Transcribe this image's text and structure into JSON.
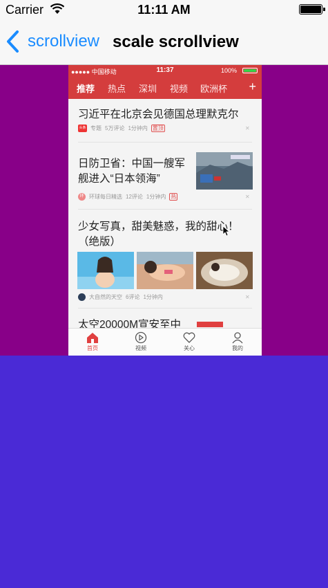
{
  "status_bar": {
    "carrier": "Carrier",
    "time": "11:11 AM"
  },
  "nav": {
    "back_label": "scrollview",
    "title": "scale scrollview"
  },
  "phone": {
    "status": {
      "carrier": "●●●●● 中国移动",
      "time": "11:37",
      "battery": "100%"
    },
    "tabs": [
      {
        "label": "推荐",
        "active": true
      },
      {
        "label": "热点"
      },
      {
        "label": "深圳"
      },
      {
        "label": "视频"
      },
      {
        "label": "欧洲杯"
      }
    ],
    "add_tab_glyph": "+",
    "feed": [
      {
        "headline": "习近平在北京会见德国总理默克尔",
        "source": "专题",
        "comments": "5万评论",
        "time": "1分钟内",
        "tag": "置顶",
        "source_badge": "头条"
      },
      {
        "headline": "日防卫省：中国一艘军舰进入“日本领海”",
        "source": "环球每日精选",
        "comments": "12评论",
        "time": "1分钟内",
        "tag": "热",
        "source_badge": "环"
      },
      {
        "headline": "少女写真，甜美魅惑，我的甜心！（绝版）",
        "source": "大自然的天空",
        "comments": "6评论",
        "time": "1分钟内"
      },
      {
        "headline": "太空20000M宣安至中"
      }
    ],
    "bottom_tabs": [
      {
        "label": "首页",
        "icon": "home-icon",
        "active": true
      },
      {
        "label": "视频",
        "icon": "video-icon"
      },
      {
        "label": "关心",
        "icon": "heart-icon"
      },
      {
        "label": "我的",
        "icon": "person-icon"
      }
    ]
  },
  "colors": {
    "accent_red": "#d43d3d",
    "stage_purple": "#880088",
    "background_indigo": "#4a2ad6",
    "ios_blue": "#1a8cff"
  }
}
